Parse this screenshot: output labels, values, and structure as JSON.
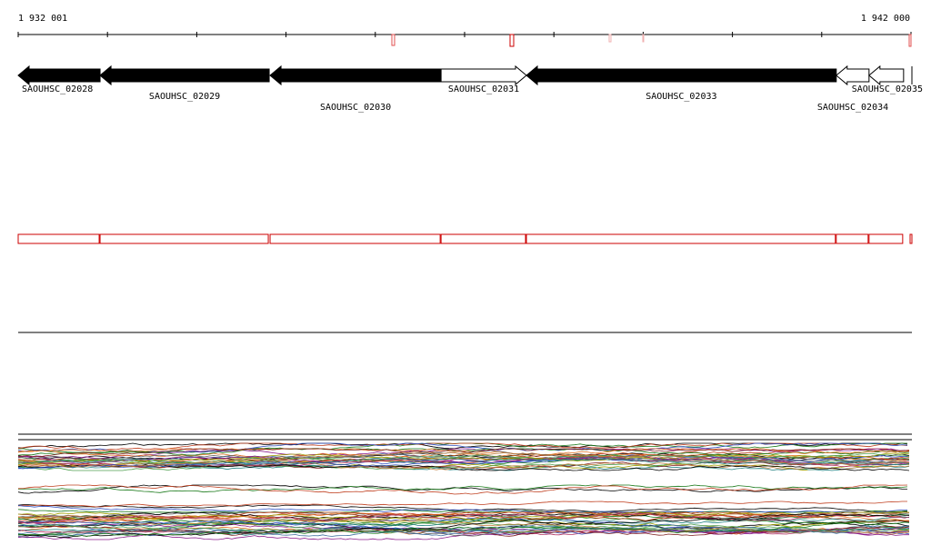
{
  "ruler": {
    "start_label": "1 932 001",
    "end_label": "1 942 000"
  },
  "genes": [
    {
      "id": "SAOUHSC_02028",
      "start": 1932001,
      "end": 1932918,
      "strand": "-",
      "fill": "#000000"
    },
    {
      "id": "SAOUHSC_02029",
      "start": 1932918,
      "end": 1934812,
      "strand": "-",
      "fill": "#000000"
    },
    {
      "id": "SAOUHSC_02030",
      "start": 1934822,
      "end": 1936737,
      "strand": "-",
      "fill": "#000000"
    },
    {
      "id": "SAOUHSC_02031",
      "start": 1936737,
      "end": 1937693,
      "strand": "+",
      "fill": "#ffffff"
    },
    {
      "id": "SAOUHSC_02033",
      "start": 1937693,
      "end": 1941163,
      "strand": "-",
      "fill": "#000000"
    },
    {
      "id": "SAOUHSC_02034",
      "start": 1941163,
      "end": 1941530,
      "strand": "-",
      "fill": "#ffffff"
    },
    {
      "id": "SAOUHSC_02035",
      "start": 1941530,
      "end": 1941917,
      "strand": "-",
      "fill": "#ffffff"
    }
  ],
  "colors": {
    "coding": "#000000",
    "outline": "#cc0000",
    "marker": "#e05050",
    "faint_marker": "#f0b0b0"
  },
  "icons": [
    "ruler-track",
    "gene-arrow"
  ]
}
